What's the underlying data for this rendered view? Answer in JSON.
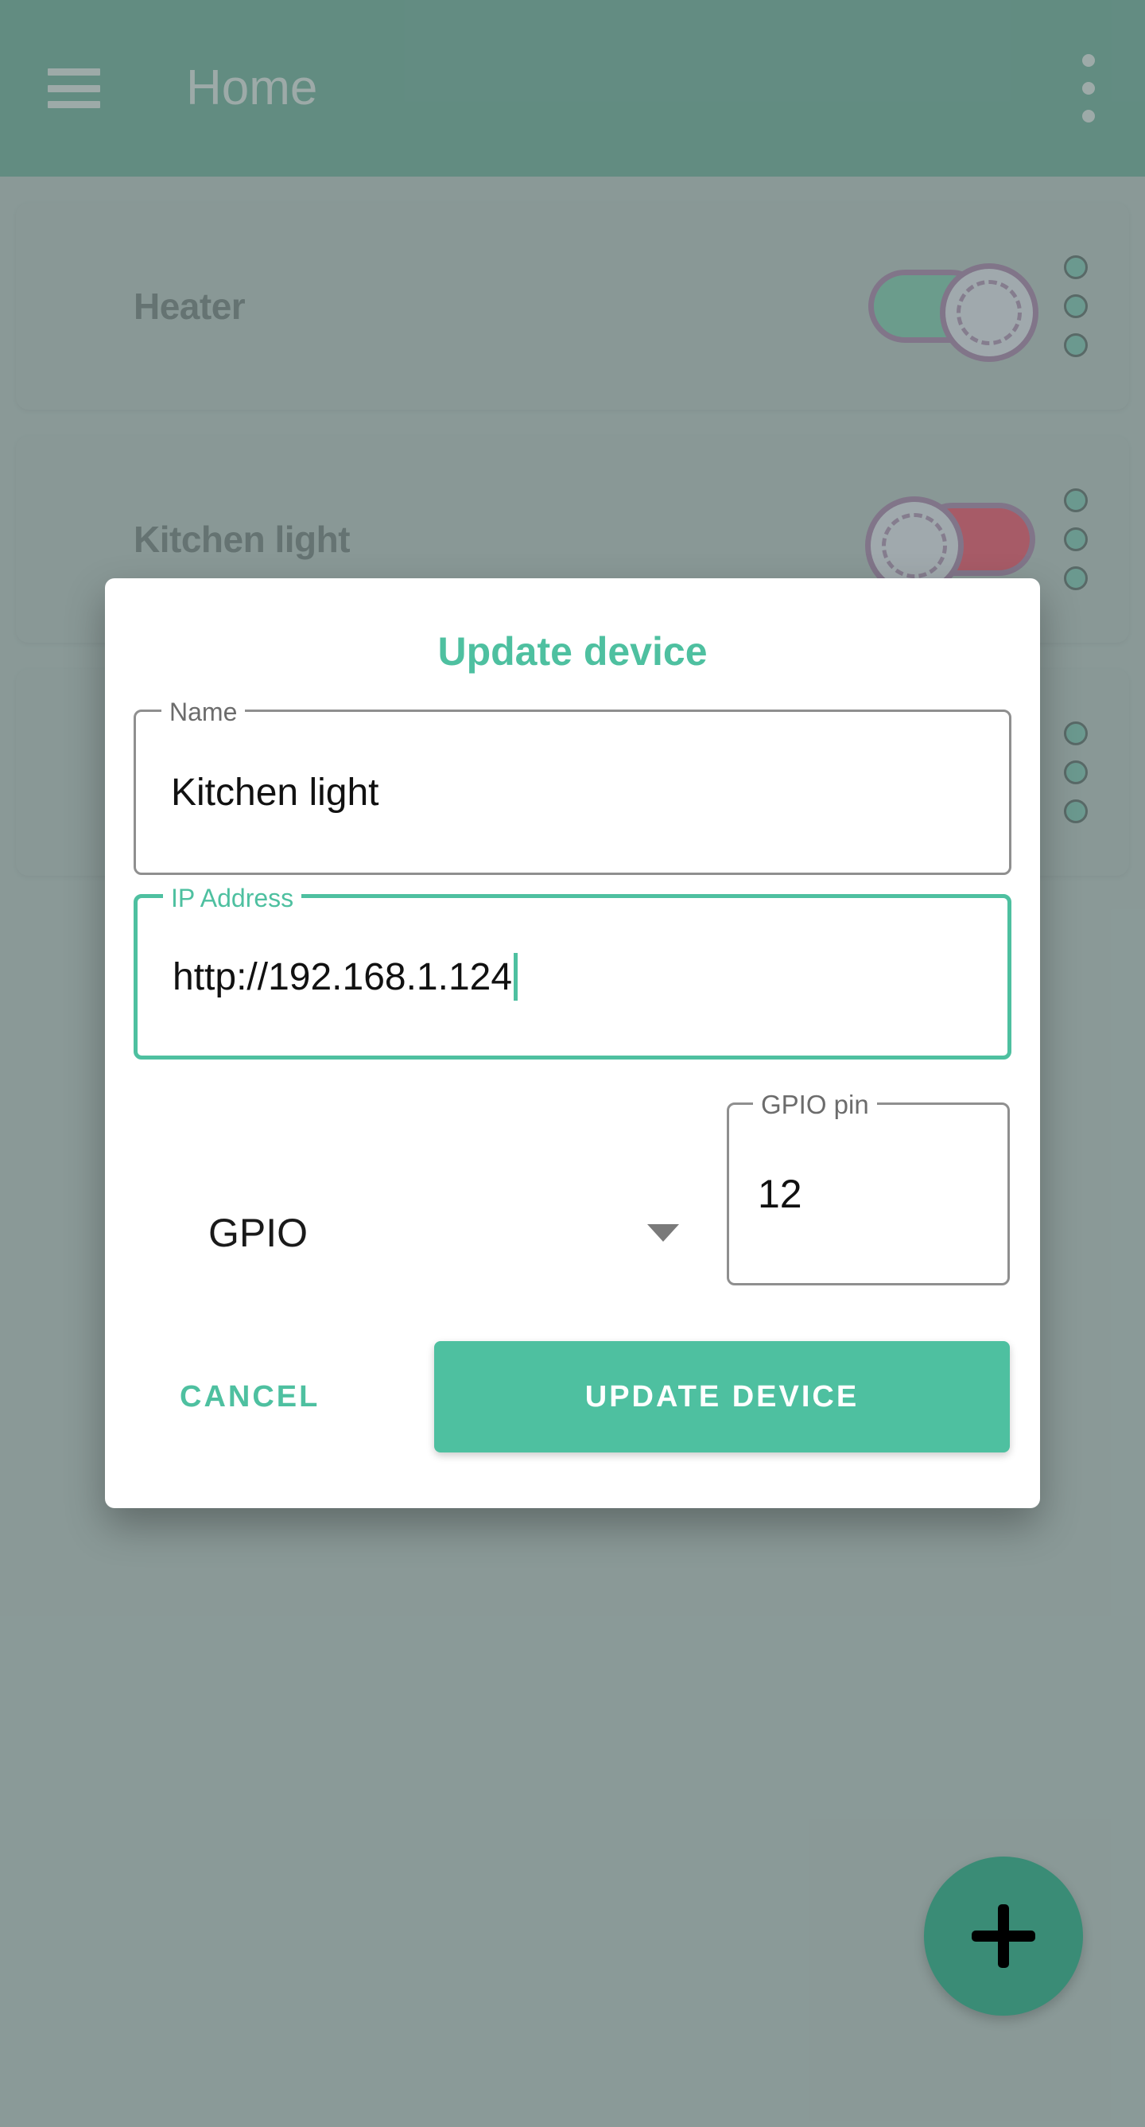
{
  "appbar": {
    "title": "Home",
    "menu_icon": "hamburger-menu-icon",
    "overflow_icon": "more-vert-icon"
  },
  "devices": [
    {
      "name": "Heater",
      "state": "on",
      "overflow_icon": "more-vert-icon"
    },
    {
      "name": "Kitchen light",
      "state": "off",
      "overflow_icon": "more-vert-icon"
    },
    {
      "name": "",
      "state": "off",
      "overflow_icon": "more-vert-icon"
    }
  ],
  "fab": {
    "icon": "plus-icon",
    "color": "#3a8c76"
  },
  "dialog": {
    "title": "Update device",
    "name_field": {
      "label": "Name",
      "value": "Kitchen light",
      "placeholder": "Name",
      "focused": false
    },
    "ip_field": {
      "label": "IP Address",
      "value": "http://192.168.1.124",
      "placeholder": "IP Address",
      "focused": true
    },
    "mode_dropdown": {
      "value": "GPIO",
      "icon": "chevron-down-icon"
    },
    "pin_field": {
      "label": "GPIO pin",
      "value": "12",
      "placeholder": "GPIO pin",
      "focused": false
    },
    "cancel_label": "CANCEL",
    "confirm_label": "UPDATE DEVICE"
  },
  "colors": {
    "appbar": "#37806c",
    "accent": "#4ec0a0",
    "scrim": "#8e9e9c",
    "toggle_on": "#4aa583",
    "toggle_off": "#cf1531",
    "toggle_outline": "#7a4f7d"
  }
}
